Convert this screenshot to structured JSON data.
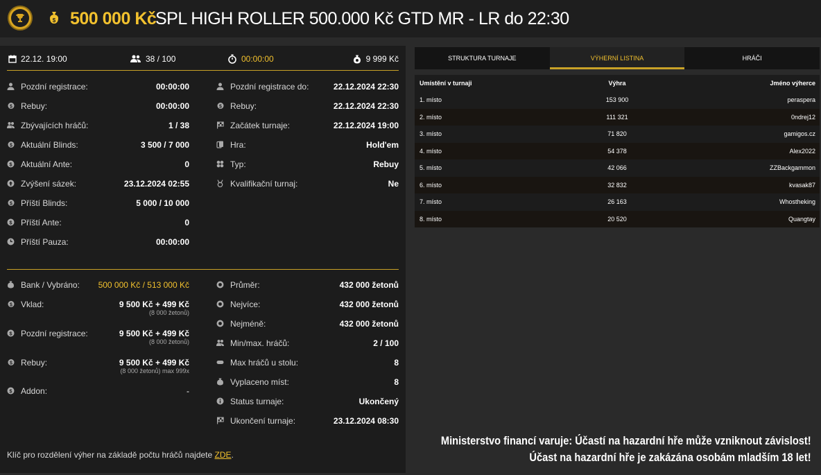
{
  "header": {
    "amount": "500 000 Kč",
    "title": "SPL HIGH ROLLER 500.000 Kč GTD MR - LR do 22:30"
  },
  "topbar": {
    "date": "22.12. 19:00",
    "players": "38 / 100",
    "timer": "00:00:00",
    "buyin": "9 999 Kč"
  },
  "info_left": [
    {
      "label": "Pozdní registrace:",
      "value": "00:00:00"
    },
    {
      "label": "Rebuy:",
      "value": "00:00:00"
    },
    {
      "label": "Zbývajících hráčů:",
      "value": "1 / 38"
    },
    {
      "label": "Aktuální Blinds:",
      "value": "3 500 / 7 000"
    },
    {
      "label": "Aktuální Ante:",
      "value": "0"
    },
    {
      "label": "Zvýšení sázek:",
      "value": "23.12.2024 02:55"
    },
    {
      "label": "Příští Blinds:",
      "value": "5 000 / 10 000"
    },
    {
      "label": "Příští Ante:",
      "value": "0"
    },
    {
      "label": "Příští Pauza:",
      "value": "00:00:00"
    }
  ],
  "info_right": [
    {
      "label": "Pozdní registrace do:",
      "value": "22.12.2024 22:30"
    },
    {
      "label": "Rebuy:",
      "value": "22.12.2024 22:30"
    },
    {
      "label": "Začátek turnaje:",
      "value": "22.12.2024 19:00"
    },
    {
      "label": "Hra:",
      "value": "Hold'em"
    },
    {
      "label": "Typ:",
      "value": "Rebuy"
    },
    {
      "label": "Kvalifikační turnaj:",
      "value": "Ne"
    }
  ],
  "money_left": [
    {
      "label": "Bank / Vybráno:",
      "value": "500 000 Kč / 513 000 Kč",
      "sub": ""
    },
    {
      "label": "Vklad:",
      "value": "9 500 Kč + 499 Kč",
      "sub": "(8 000 žetonů)"
    },
    {
      "label": "Pozdní registrace:",
      "value": "9 500 Kč + 499 Kč",
      "sub": "(8 000 žetonů)"
    },
    {
      "label": "Rebuy:",
      "value": "9 500 Kč + 499 Kč",
      "sub": "(8 000 žetonů) max 999x"
    },
    {
      "label": "Addon:",
      "value": "-",
      "sub": ""
    }
  ],
  "stats_right": [
    {
      "label": "Průměr:",
      "value": "432 000 žetonů"
    },
    {
      "label": "Nejvíce:",
      "value": "432 000 žetonů"
    },
    {
      "label": "Nejméně:",
      "value": "432 000 žetonů"
    },
    {
      "label": "Min/max. hráčů:",
      "value": "2 / 100"
    },
    {
      "label": "Max hráčů u stolu:",
      "value": "8"
    },
    {
      "label": "Vyplaceno míst:",
      "value": "8"
    },
    {
      "label": "Status turnaje:",
      "value": "Ukončený"
    },
    {
      "label": "Ukončení turnaje:",
      "value": "23.12.2024 08:30"
    }
  ],
  "footer": {
    "text": "Klíč pro rozdělení výher na základě počtu hráčů najdete ",
    "link": "ZDE",
    "end": "."
  },
  "tabs": [
    "STRUKTURA TURNAJE",
    "VÝHERNÍ LISTINA",
    "HRÁČI"
  ],
  "payout": {
    "headers": [
      "Umístění v turnaji",
      "Výhra",
      "Jméno výherce"
    ],
    "rows": [
      [
        "1. místo",
        "153 900",
        "peraspera"
      ],
      [
        "2. místo",
        "111 321",
        "0ndrej12"
      ],
      [
        "3. místo",
        "71 820",
        "gamigos.cz"
      ],
      [
        "4. místo",
        "54 378",
        "Alex2022"
      ],
      [
        "5. místo",
        "42 066",
        "ZZBackgammon"
      ],
      [
        "6. místo",
        "32 832",
        "kvasak87"
      ],
      [
        "7. místo",
        "26 163",
        "Whostheking"
      ],
      [
        "8. místo",
        "20 520",
        "Quangtay"
      ]
    ]
  },
  "warning": {
    "line1": "Ministerstvo financí varuje: Účastí na hazardní hře může vzniknout závislost!",
    "line2": "Účast na hazardní hře je zakázána osobám mladším 18 let!"
  },
  "colors": {
    "accent": "#f2c12e",
    "panel": "#1c1c1c",
    "background": "#2a2a2a"
  }
}
